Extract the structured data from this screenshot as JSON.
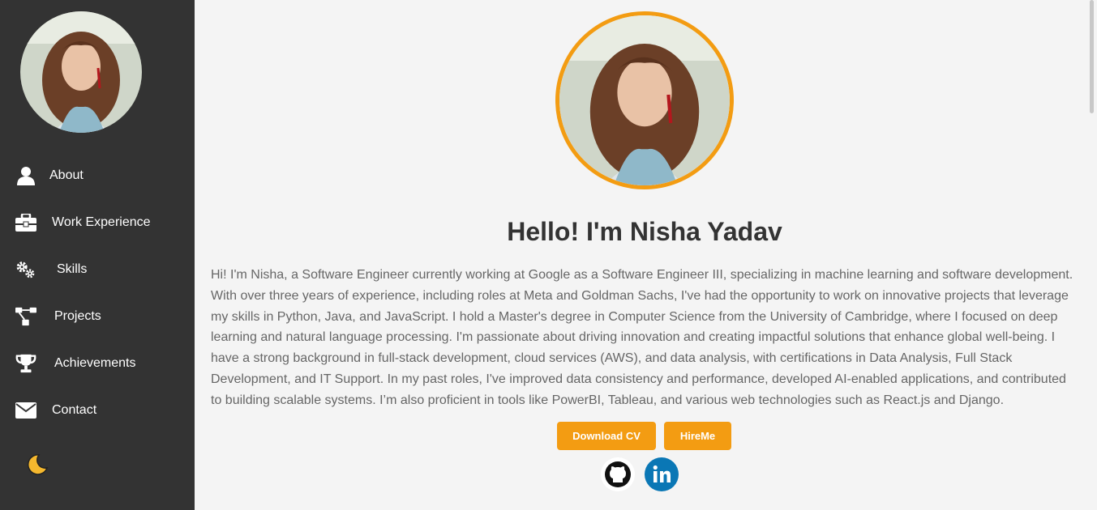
{
  "sidebar": {
    "avatar_alt": "Profile photo",
    "items": [
      {
        "label": "About",
        "icon": "user-icon"
      },
      {
        "label": "Work Experience",
        "icon": "briefcase-icon"
      },
      {
        "label": "Skills",
        "icon": "gears-icon"
      },
      {
        "label": "Projects",
        "icon": "project-diagram-icon"
      },
      {
        "label": "Achievements",
        "icon": "trophy-icon"
      },
      {
        "label": "Contact",
        "icon": "envelope-icon"
      }
    ],
    "theme_toggle_icon": "moon-icon"
  },
  "main": {
    "title": "Hello! I'm Nisha Yadav",
    "bio": "Hi! I'm Nisha, a Software Engineer currently working at Google as a Software Engineer III, specializing in machine learning and software development. With over three years of experience, including roles at Meta and Goldman Sachs, I've had the opportunity to work on innovative projects that leverage my skills in Python, Java, and JavaScript. I hold a Master's degree in Computer Science from the University of Cambridge, where I focused on deep learning and natural language processing. I'm passionate about driving innovation and creating impactful solutions that enhance global well-being. I have a strong background in full-stack development, cloud services (AWS), and data analysis, with certifications in Data Analysis, Full Stack Development, and IT Support. In my past roles, I've improved data consistency and performance, developed AI-enabled applications, and contributed to building scalable systems. I’m also proficient in tools like PowerBI, Tableau, and various web technologies such as React.js and Django.",
    "buttons": {
      "download_cv": "Download CV",
      "hire_me": "HireMe"
    },
    "social": [
      "github-icon",
      "linkedin-icon"
    ]
  },
  "colors": {
    "sidebar_bg": "#333333",
    "accent": "#f39c12",
    "page_bg": "#f4f4f4",
    "linkedin": "#0a77b5"
  }
}
